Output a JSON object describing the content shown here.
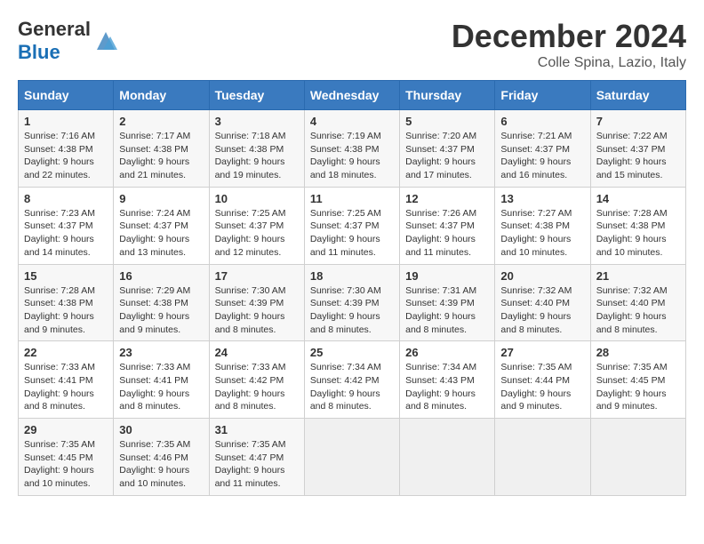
{
  "header": {
    "logo_general": "General",
    "logo_blue": "Blue",
    "title": "December 2024",
    "subtitle": "Colle Spina, Lazio, Italy"
  },
  "days_of_week": [
    "Sunday",
    "Monday",
    "Tuesday",
    "Wednesday",
    "Thursday",
    "Friday",
    "Saturday"
  ],
  "weeks": [
    [
      {
        "day": "1",
        "sunrise": "7:16 AM",
        "sunset": "4:38 PM",
        "daylight": "9 hours and 22 minutes."
      },
      {
        "day": "2",
        "sunrise": "7:17 AM",
        "sunset": "4:38 PM",
        "daylight": "9 hours and 21 minutes."
      },
      {
        "day": "3",
        "sunrise": "7:18 AM",
        "sunset": "4:38 PM",
        "daylight": "9 hours and 19 minutes."
      },
      {
        "day": "4",
        "sunrise": "7:19 AM",
        "sunset": "4:38 PM",
        "daylight": "9 hours and 18 minutes."
      },
      {
        "day": "5",
        "sunrise": "7:20 AM",
        "sunset": "4:37 PM",
        "daylight": "9 hours and 17 minutes."
      },
      {
        "day": "6",
        "sunrise": "7:21 AM",
        "sunset": "4:37 PM",
        "daylight": "9 hours and 16 minutes."
      },
      {
        "day": "7",
        "sunrise": "7:22 AM",
        "sunset": "4:37 PM",
        "daylight": "9 hours and 15 minutes."
      }
    ],
    [
      {
        "day": "8",
        "sunrise": "7:23 AM",
        "sunset": "4:37 PM",
        "daylight": "9 hours and 14 minutes."
      },
      {
        "day": "9",
        "sunrise": "7:24 AM",
        "sunset": "4:37 PM",
        "daylight": "9 hours and 13 minutes."
      },
      {
        "day": "10",
        "sunrise": "7:25 AM",
        "sunset": "4:37 PM",
        "daylight": "9 hours and 12 minutes."
      },
      {
        "day": "11",
        "sunrise": "7:25 AM",
        "sunset": "4:37 PM",
        "daylight": "9 hours and 11 minutes."
      },
      {
        "day": "12",
        "sunrise": "7:26 AM",
        "sunset": "4:37 PM",
        "daylight": "9 hours and 11 minutes."
      },
      {
        "day": "13",
        "sunrise": "7:27 AM",
        "sunset": "4:38 PM",
        "daylight": "9 hours and 10 minutes."
      },
      {
        "day": "14",
        "sunrise": "7:28 AM",
        "sunset": "4:38 PM",
        "daylight": "9 hours and 10 minutes."
      }
    ],
    [
      {
        "day": "15",
        "sunrise": "7:28 AM",
        "sunset": "4:38 PM",
        "daylight": "9 hours and 9 minutes."
      },
      {
        "day": "16",
        "sunrise": "7:29 AM",
        "sunset": "4:38 PM",
        "daylight": "9 hours and 9 minutes."
      },
      {
        "day": "17",
        "sunrise": "7:30 AM",
        "sunset": "4:39 PM",
        "daylight": "9 hours and 8 minutes."
      },
      {
        "day": "18",
        "sunrise": "7:30 AM",
        "sunset": "4:39 PM",
        "daylight": "9 hours and 8 minutes."
      },
      {
        "day": "19",
        "sunrise": "7:31 AM",
        "sunset": "4:39 PM",
        "daylight": "9 hours and 8 minutes."
      },
      {
        "day": "20",
        "sunrise": "7:32 AM",
        "sunset": "4:40 PM",
        "daylight": "9 hours and 8 minutes."
      },
      {
        "day": "21",
        "sunrise": "7:32 AM",
        "sunset": "4:40 PM",
        "daylight": "9 hours and 8 minutes."
      }
    ],
    [
      {
        "day": "22",
        "sunrise": "7:33 AM",
        "sunset": "4:41 PM",
        "daylight": "9 hours and 8 minutes."
      },
      {
        "day": "23",
        "sunrise": "7:33 AM",
        "sunset": "4:41 PM",
        "daylight": "9 hours and 8 minutes."
      },
      {
        "day": "24",
        "sunrise": "7:33 AM",
        "sunset": "4:42 PM",
        "daylight": "9 hours and 8 minutes."
      },
      {
        "day": "25",
        "sunrise": "7:34 AM",
        "sunset": "4:42 PM",
        "daylight": "9 hours and 8 minutes."
      },
      {
        "day": "26",
        "sunrise": "7:34 AM",
        "sunset": "4:43 PM",
        "daylight": "9 hours and 8 minutes."
      },
      {
        "day": "27",
        "sunrise": "7:35 AM",
        "sunset": "4:44 PM",
        "daylight": "9 hours and 9 minutes."
      },
      {
        "day": "28",
        "sunrise": "7:35 AM",
        "sunset": "4:45 PM",
        "daylight": "9 hours and 9 minutes."
      }
    ],
    [
      {
        "day": "29",
        "sunrise": "7:35 AM",
        "sunset": "4:45 PM",
        "daylight": "9 hours and 10 minutes."
      },
      {
        "day": "30",
        "sunrise": "7:35 AM",
        "sunset": "4:46 PM",
        "daylight": "9 hours and 10 minutes."
      },
      {
        "day": "31",
        "sunrise": "7:35 AM",
        "sunset": "4:47 PM",
        "daylight": "9 hours and 11 minutes."
      },
      null,
      null,
      null,
      null
    ]
  ]
}
